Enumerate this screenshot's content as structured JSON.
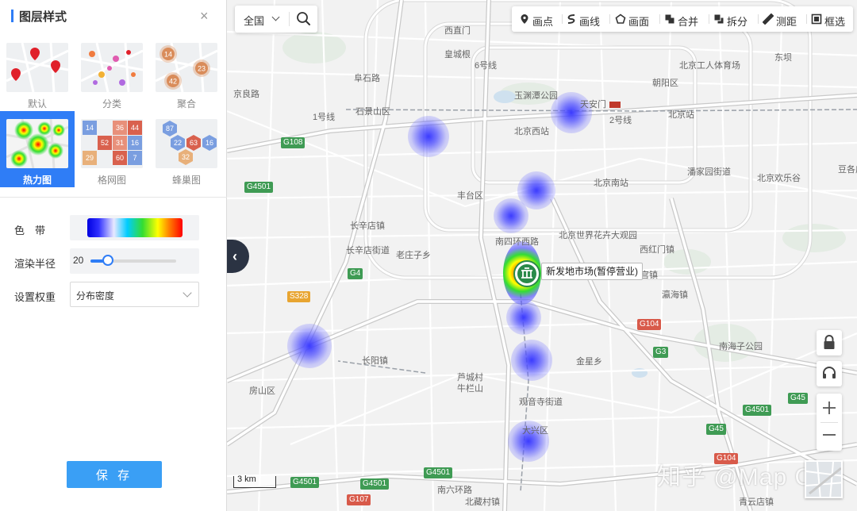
{
  "panel": {
    "title": "图层样式",
    "close_glyph": "×",
    "styles": [
      {
        "label": "默认",
        "active": false
      },
      {
        "label": "分类",
        "active": false
      },
      {
        "label": "聚合",
        "active": false
      },
      {
        "label": "热力图",
        "active": true
      },
      {
        "label": "格网图",
        "active": false
      },
      {
        "label": "蜂巢图",
        "active": false
      }
    ],
    "thumb_numbers": {
      "cluster": [
        "14",
        "42",
        "23"
      ],
      "grid": [
        "14",
        "36",
        "44",
        "52",
        "31",
        "16",
        "29",
        "60",
        "7"
      ],
      "hex": [
        "87",
        "22",
        "63",
        "16",
        "32"
      ]
    },
    "settings": {
      "color_band_label": "色　带",
      "radius_label": "渲染半径",
      "radius_value": "20",
      "radius_fraction": 0.2,
      "weight_label": "设置权重",
      "weight_value": "分布密度"
    },
    "save_label": "保 存"
  },
  "search": {
    "region": "全国"
  },
  "toolbar": {
    "tools": [
      {
        "label": "画点",
        "icon": "map-pin-icon"
      },
      {
        "label": "画线",
        "icon": "draw-line-icon"
      },
      {
        "label": "画面",
        "icon": "polygon-icon"
      },
      {
        "label": "合并",
        "icon": "merge-icon"
      },
      {
        "label": "拆分",
        "icon": "split-icon"
      },
      {
        "label": "测距",
        "icon": "ruler-icon"
      },
      {
        "label": "框选",
        "icon": "box-select-icon"
      }
    ]
  },
  "map": {
    "scale_label": "3 km",
    "watermark": "知乎 @Map Cat",
    "poi_label": "新发地市场(暂停营业)",
    "places": [
      {
        "t": "西直门"
      },
      {
        "t": "皇城根"
      },
      {
        "t": "6号线"
      },
      {
        "t": "北京工人体育场"
      },
      {
        "t": "阜石路"
      },
      {
        "t": "玉渊潭公园"
      },
      {
        "t": "天安门"
      },
      {
        "t": "北京站"
      },
      {
        "t": "石景山区"
      },
      {
        "t": "北京西站"
      },
      {
        "t": "2号线"
      },
      {
        "t": "1号线"
      },
      {
        "t": "丰台区"
      },
      {
        "t": "北京南站"
      },
      {
        "t": "北京欢乐谷"
      },
      {
        "t": "长辛店镇"
      },
      {
        "t": "南四环西路"
      },
      {
        "t": "北京世界花卉大观园"
      },
      {
        "t": "长辛店街道"
      },
      {
        "t": "老庄子乡"
      },
      {
        "t": "旧宫镇"
      },
      {
        "t": "瀛海镇"
      },
      {
        "t": "南海子公园"
      },
      {
        "t": "金星乡"
      },
      {
        "t": "长阳镇"
      },
      {
        "t": "芦城村"
      },
      {
        "t": "牛栏山"
      },
      {
        "t": "观音寺街道"
      },
      {
        "t": "大兴区"
      },
      {
        "t": "房山区"
      },
      {
        "t": "南六环路"
      },
      {
        "t": "北藏村镇"
      },
      {
        "t": "青云店镇"
      },
      {
        "t": "潘家园街道"
      },
      {
        "t": "朝阳区"
      },
      {
        "t": "西红门镇"
      },
      {
        "t": "豆各庄"
      },
      {
        "t": "东坝"
      },
      {
        "t": "京良路"
      }
    ],
    "shields": [
      {
        "t": "G108",
        "k": "g"
      },
      {
        "t": "G4501",
        "k": "g"
      },
      {
        "t": "G4",
        "k": "g"
      },
      {
        "t": "S328",
        "k": "s"
      },
      {
        "t": "G104",
        "k": "r"
      },
      {
        "t": "G3",
        "k": "g"
      },
      {
        "t": "G45",
        "k": "g"
      },
      {
        "t": "G4501",
        "k": "g"
      },
      {
        "t": "G45",
        "k": "g"
      },
      {
        "t": "G4501",
        "k": "g"
      },
      {
        "t": "G4501",
        "k": "g"
      },
      {
        "t": "G107",
        "k": "r"
      },
      {
        "t": "G104",
        "k": "r"
      },
      {
        "t": "G4501",
        "k": "g"
      }
    ]
  },
  "colors": {
    "accent": "#2f7df6",
    "save": "#3a9ff5",
    "heat_cold": "#3b3bff",
    "heat_hot": "#ff0000"
  }
}
